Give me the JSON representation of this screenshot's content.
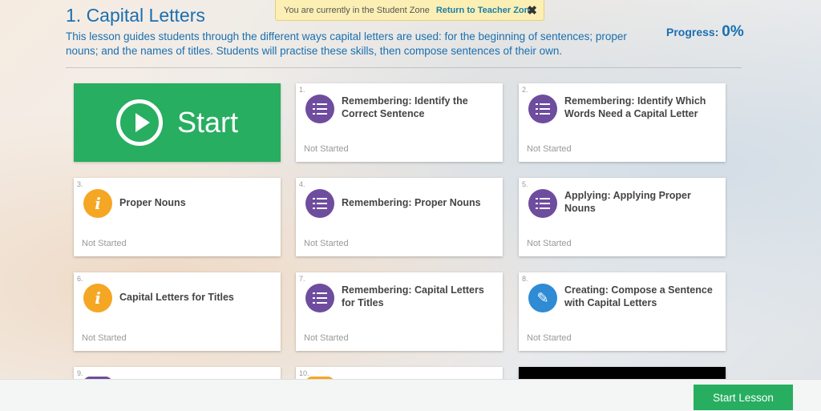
{
  "banner": {
    "text": "You are currently in the Student Zone",
    "link": "Return to Teacher Zone",
    "close_icon": "✖"
  },
  "lesson": {
    "title": "1. Capital Letters",
    "description": "This lesson guides students through the different ways capital letters are used: for the beginning of sentences; proper nouns; and the names of titles. Students will practise these skills, then compose sentences of their own.",
    "progress_label": "Progress:",
    "progress_value": "0%"
  },
  "start_card": {
    "label": "Start",
    "icon": "play-circle-icon"
  },
  "cards": [
    {
      "num": "1.",
      "title": "Remembering: Identify the Correct Sentence",
      "status": "Not Started",
      "icon": "checklist-icon"
    },
    {
      "num": "2.",
      "title": "Remembering: Identify Which Words Need a Capital Letter",
      "status": "Not Started",
      "icon": "checklist-icon"
    },
    {
      "num": "3.",
      "title": "Proper Nouns",
      "status": "Not Started",
      "icon": "info-icon"
    },
    {
      "num": "4.",
      "title": "Remembering: Proper Nouns",
      "status": "Not Started",
      "icon": "checklist-icon"
    },
    {
      "num": "5.",
      "title": "Applying: Applying Proper Nouns",
      "status": "Not Started",
      "icon": "checklist-icon"
    },
    {
      "num": "6.",
      "title": "Capital Letters for Titles",
      "status": "Not Started",
      "icon": "info-icon"
    },
    {
      "num": "7.",
      "title": "Remembering: Capital Letters for Titles",
      "status": "Not Started",
      "icon": "checklist-icon"
    },
    {
      "num": "8.",
      "title": "Creating: Compose a Sentence with Capital Letters",
      "status": "Not Started",
      "icon": "pencil-icon"
    },
    {
      "num": "9."
    },
    {
      "num": "10."
    }
  ],
  "colors": {
    "accent_green": "#27ae60",
    "title_blue": "#1a6fb0",
    "checklist_purple": "#6e4c9e",
    "info_orange": "#f5a623",
    "pencil_blue": "#2e8bd4"
  },
  "footer": {
    "start_lesson_label": "Start Lesson"
  }
}
